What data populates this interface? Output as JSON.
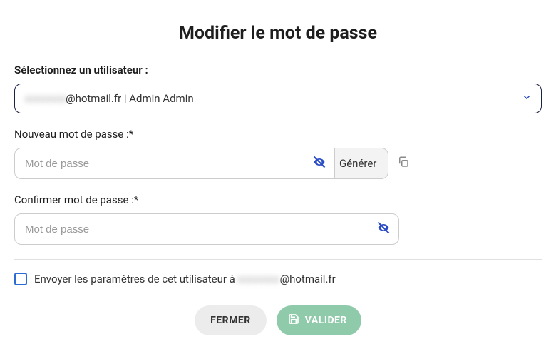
{
  "title": "Modifier le mot de passe",
  "user_select": {
    "label": "Sélectionnez un utilisateur :",
    "value_prefix": "xxxxxxx",
    "value_suffix": "@hotmail.fr | Admin Admin"
  },
  "new_password": {
    "label": "Nouveau mot de passe :*",
    "placeholder": "Mot de passe"
  },
  "confirm_password": {
    "label": "Confirmer mot de passe :*",
    "placeholder": "Mot de passe"
  },
  "generate_label": "Générer",
  "send_params": {
    "prefix": "Envoyer les paramètres de cet utilisateur à ",
    "blur": "xxxxxxx",
    "suffix": "@hotmail.fr"
  },
  "actions": {
    "close": "FERMER",
    "validate": "VALIDER"
  }
}
